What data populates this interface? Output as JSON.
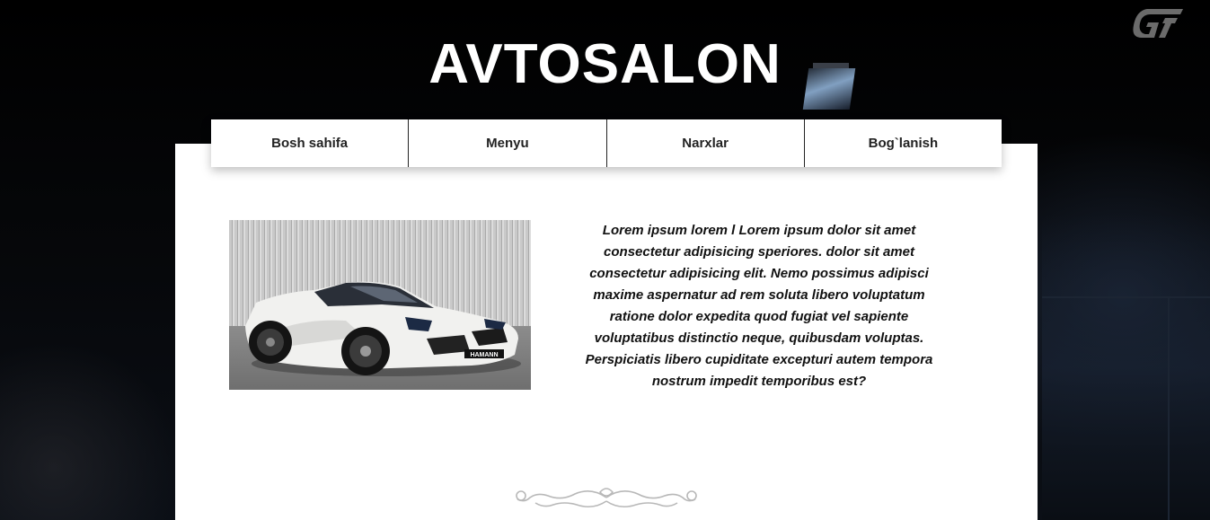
{
  "header": {
    "title": "AVTOSALON"
  },
  "nav": {
    "items": [
      {
        "label": "Bosh sahifa"
      },
      {
        "label": "Menyu"
      },
      {
        "label": "Narxlar"
      },
      {
        "label": "Bog`lanish"
      }
    ]
  },
  "main": {
    "description": "Lorem ipsum lorem l Lorem ipsum dolor sit amet consectetur adipisicing speriores. dolor sit amet consectetur adipisicing elit. Nemo possimus adipisci maxime aspernatur ad rem soluta libero voluptatum ratione dolor expedita quod fugiat vel sapiente voluptatibus distinctio neque, quibusdam voluptas. Perspiciatis libero cupiditate excepturi autem tempora nostrum impedit temporibus est?",
    "car_plate": "HAMANN"
  },
  "icons": {
    "corner_logo": "gt-logo-icon",
    "ornament": "flourish-divider-icon"
  },
  "colors": {
    "background": "#000000",
    "panel": "#ffffff",
    "text": "#111111",
    "title": "#ffffff"
  }
}
